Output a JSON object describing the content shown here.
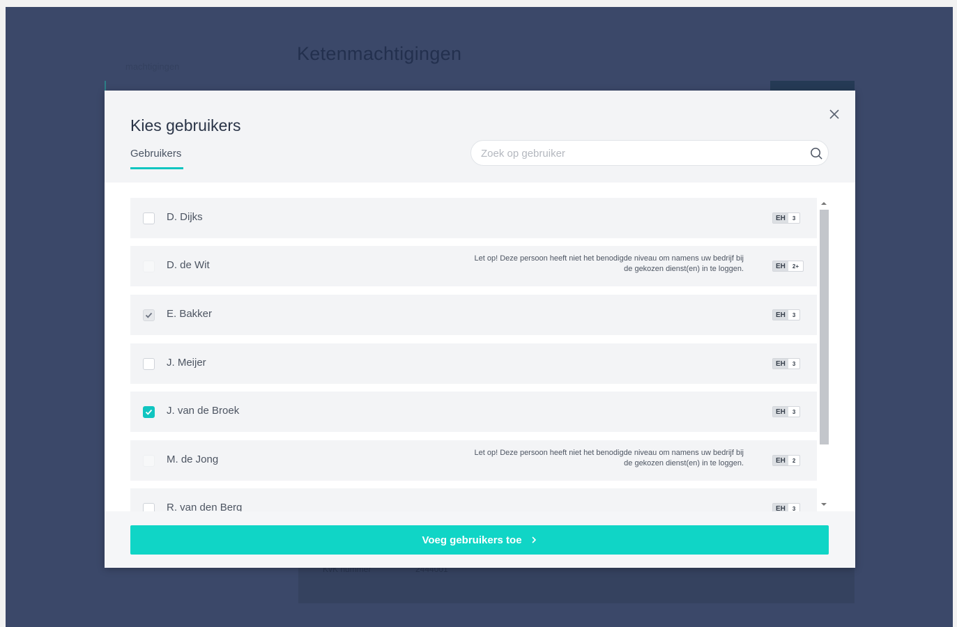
{
  "background": {
    "nav_item": "machtigingen",
    "page_title": "Ketenmachtigingen",
    "kvk_label": "KvK nummer",
    "kvk_value": "2444001"
  },
  "modal": {
    "title": "Kies gebruikers",
    "tab_label": "Gebruikers",
    "search_placeholder": "Zoek op gebruiker",
    "submit_label": "Voeg gebruikers toe",
    "users": [
      {
        "name": "D. Dijks",
        "checkbox": "unchecked",
        "warning": "",
        "badge": "EH",
        "level": "3"
      },
      {
        "name": "D. de Wit",
        "checkbox": "disabled",
        "warning": "Let op! Deze persoon heeft niet het benodigde niveau om namens uw bedrijf bij de gekozen dienst(en) in te loggen.",
        "badge": "EH",
        "level": "2+"
      },
      {
        "name": "E. Bakker",
        "checkbox": "checked-disabled",
        "warning": "",
        "badge": "EH",
        "level": "3"
      },
      {
        "name": "J. Meijer",
        "checkbox": "unchecked",
        "warning": "",
        "badge": "EH",
        "level": "3"
      },
      {
        "name": "J. van de Broek",
        "checkbox": "checked",
        "warning": "",
        "badge": "EH",
        "level": "3"
      },
      {
        "name": "M. de Jong",
        "checkbox": "disabled",
        "warning": "Let op! Deze persoon heeft niet het benodigde niveau om namens uw bedrijf bij de gekozen dienst(en) in te loggen.",
        "badge": "EH",
        "level": "2"
      },
      {
        "name": "R. van den Berg",
        "checkbox": "unchecked",
        "warning": "",
        "badge": "EH",
        "level": "3"
      }
    ]
  },
  "colors": {
    "overlay": "#3b4869",
    "accent": "#10c5c0",
    "button": "#10d5c6"
  },
  "icons": {
    "close": "close-icon",
    "search": "search-icon",
    "chevron": "chevron-right-icon",
    "check": "check-icon"
  }
}
